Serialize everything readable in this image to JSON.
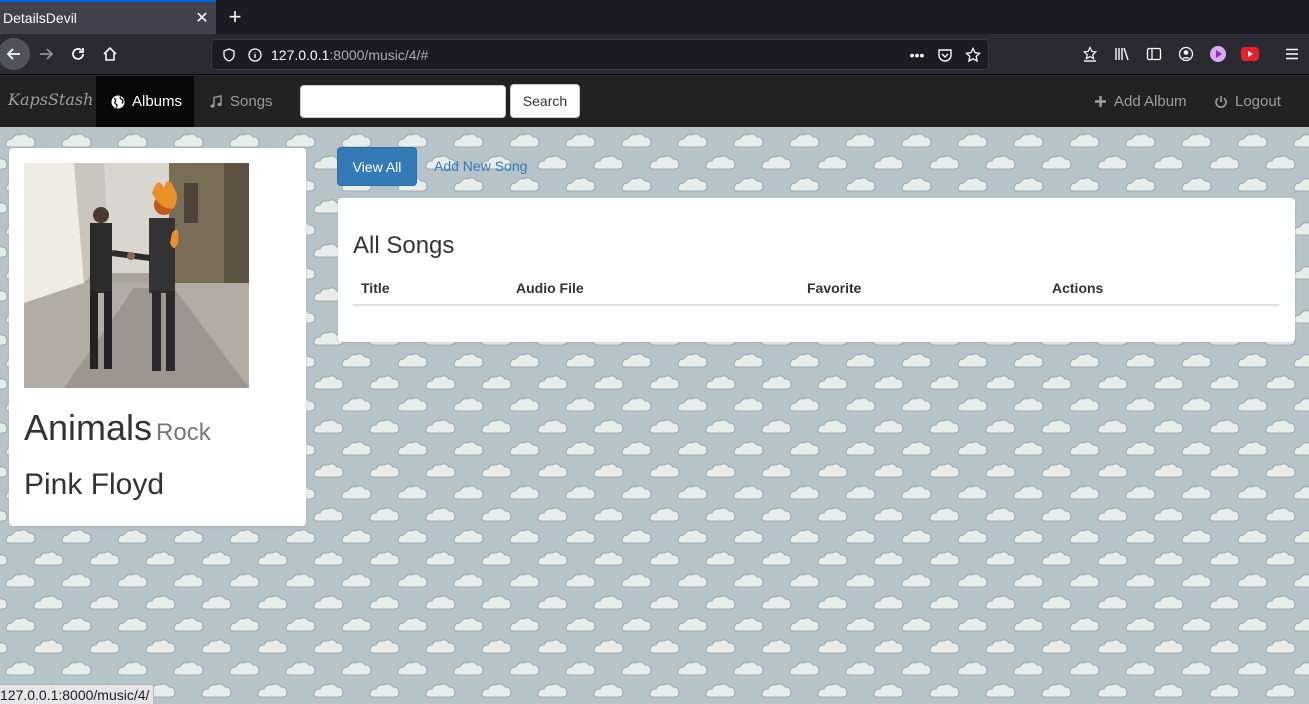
{
  "browser": {
    "tab_title": "DetailsDevil",
    "url_host": "127.0.0.1",
    "url_rest": ":8000/music/4/#",
    "status_url": "127.0.0.1:8000/music/4/"
  },
  "site": {
    "brand": "KapsStash",
    "nav": {
      "albums_label": "Albums",
      "songs_label": "Songs",
      "search_value": "",
      "search_button": "Search",
      "add_album_label": "Add Album",
      "logout_label": "Logout"
    }
  },
  "album": {
    "title": "Animals",
    "genre": "Rock",
    "artist": "Pink Floyd"
  },
  "actions": {
    "view_all": "View All",
    "add_new_song": "Add New Song"
  },
  "songs_panel": {
    "title": "All Songs",
    "columns": [
      "Title",
      "Audio File",
      "Favorite",
      "Actions"
    ],
    "rows": []
  },
  "colors": {
    "primary": "#337ab7",
    "navbar": "#222222",
    "page_background": "#b5c3c9"
  }
}
